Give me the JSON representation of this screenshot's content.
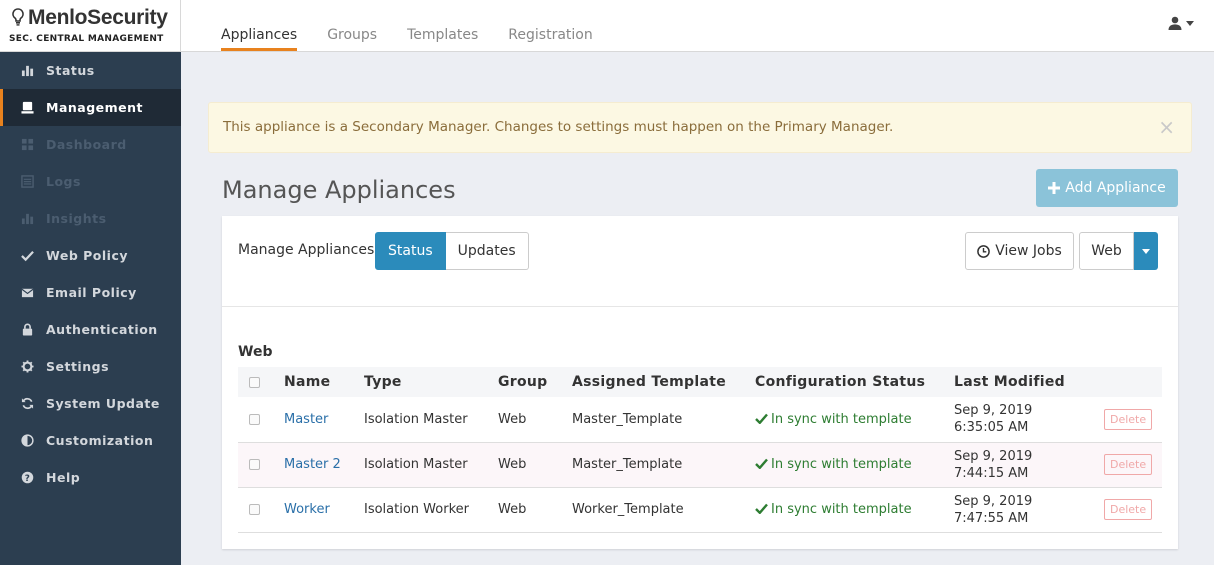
{
  "brand": {
    "name": "MenloSecurity",
    "subtitle": "SEC. CENTRAL MANAGEMENT"
  },
  "tabs": [
    {
      "label": "Appliances",
      "active": true
    },
    {
      "label": "Groups"
    },
    {
      "label": "Templates"
    },
    {
      "label": "Registration"
    }
  ],
  "user_icon": "user-icon",
  "sidebar": {
    "items": [
      {
        "label": "Status",
        "icon": "bar-chart-icon"
      },
      {
        "label": "Management",
        "icon": "server-icon",
        "active": true
      },
      {
        "label": "Dashboard",
        "icon": "dashboard-icon",
        "disabled": true
      },
      {
        "label": "Logs",
        "icon": "list-icon",
        "disabled": true
      },
      {
        "label": "Insights",
        "icon": "bar-chart-icon",
        "disabled": true
      },
      {
        "label": "Web Policy",
        "icon": "check-icon"
      },
      {
        "label": "Email Policy",
        "icon": "envelope-icon"
      },
      {
        "label": "Authentication",
        "icon": "lock-icon"
      },
      {
        "label": "Settings",
        "icon": "gear-icon"
      },
      {
        "label": "System Update",
        "icon": "refresh-icon"
      },
      {
        "label": "Customization",
        "icon": "adjust-icon"
      },
      {
        "label": "Help",
        "icon": "question-icon"
      }
    ]
  },
  "alert": {
    "text": "This appliance is a Secondary Manager. Changes to settings must happen on the Primary Manager.",
    "close": "×"
  },
  "page": {
    "title": "Manage Appliances",
    "add_button": "Add Appliance"
  },
  "panel": {
    "label": "Manage Appliances",
    "status_tab": "Status",
    "updates_tab": "Updates",
    "view_jobs": "View Jobs",
    "filter": "Web",
    "section": "Web"
  },
  "table": {
    "columns": [
      "Name",
      "Type",
      "Group",
      "Assigned Template",
      "Configuration Status",
      "Last Modified"
    ],
    "rows": [
      {
        "name": "Master",
        "type": "Isolation Master",
        "group": "Web",
        "template": "Master_Template",
        "status": "In sync with template",
        "date": "Sep 9, 2019",
        "time": "6:35:05 AM",
        "action": "Delete"
      },
      {
        "name": "Master 2",
        "type": "Isolation Master",
        "group": "Web",
        "template": "Master_Template",
        "status": "In sync with template",
        "date": "Sep 9, 2019",
        "time": "7:44:15 AM",
        "action": "Delete"
      },
      {
        "name": "Worker",
        "type": "Isolation Worker",
        "group": "Web",
        "template": "Worker_Template",
        "status": "In sync with template",
        "date": "Sep 9, 2019",
        "time": "7:47:55 AM",
        "action": "Delete"
      }
    ]
  },
  "colors": {
    "accent": "#e8821e",
    "primary": "#2b8bbb",
    "sidebar": "#2c3e50",
    "success": "#2e7d32",
    "danger": "#f0a8a8"
  }
}
